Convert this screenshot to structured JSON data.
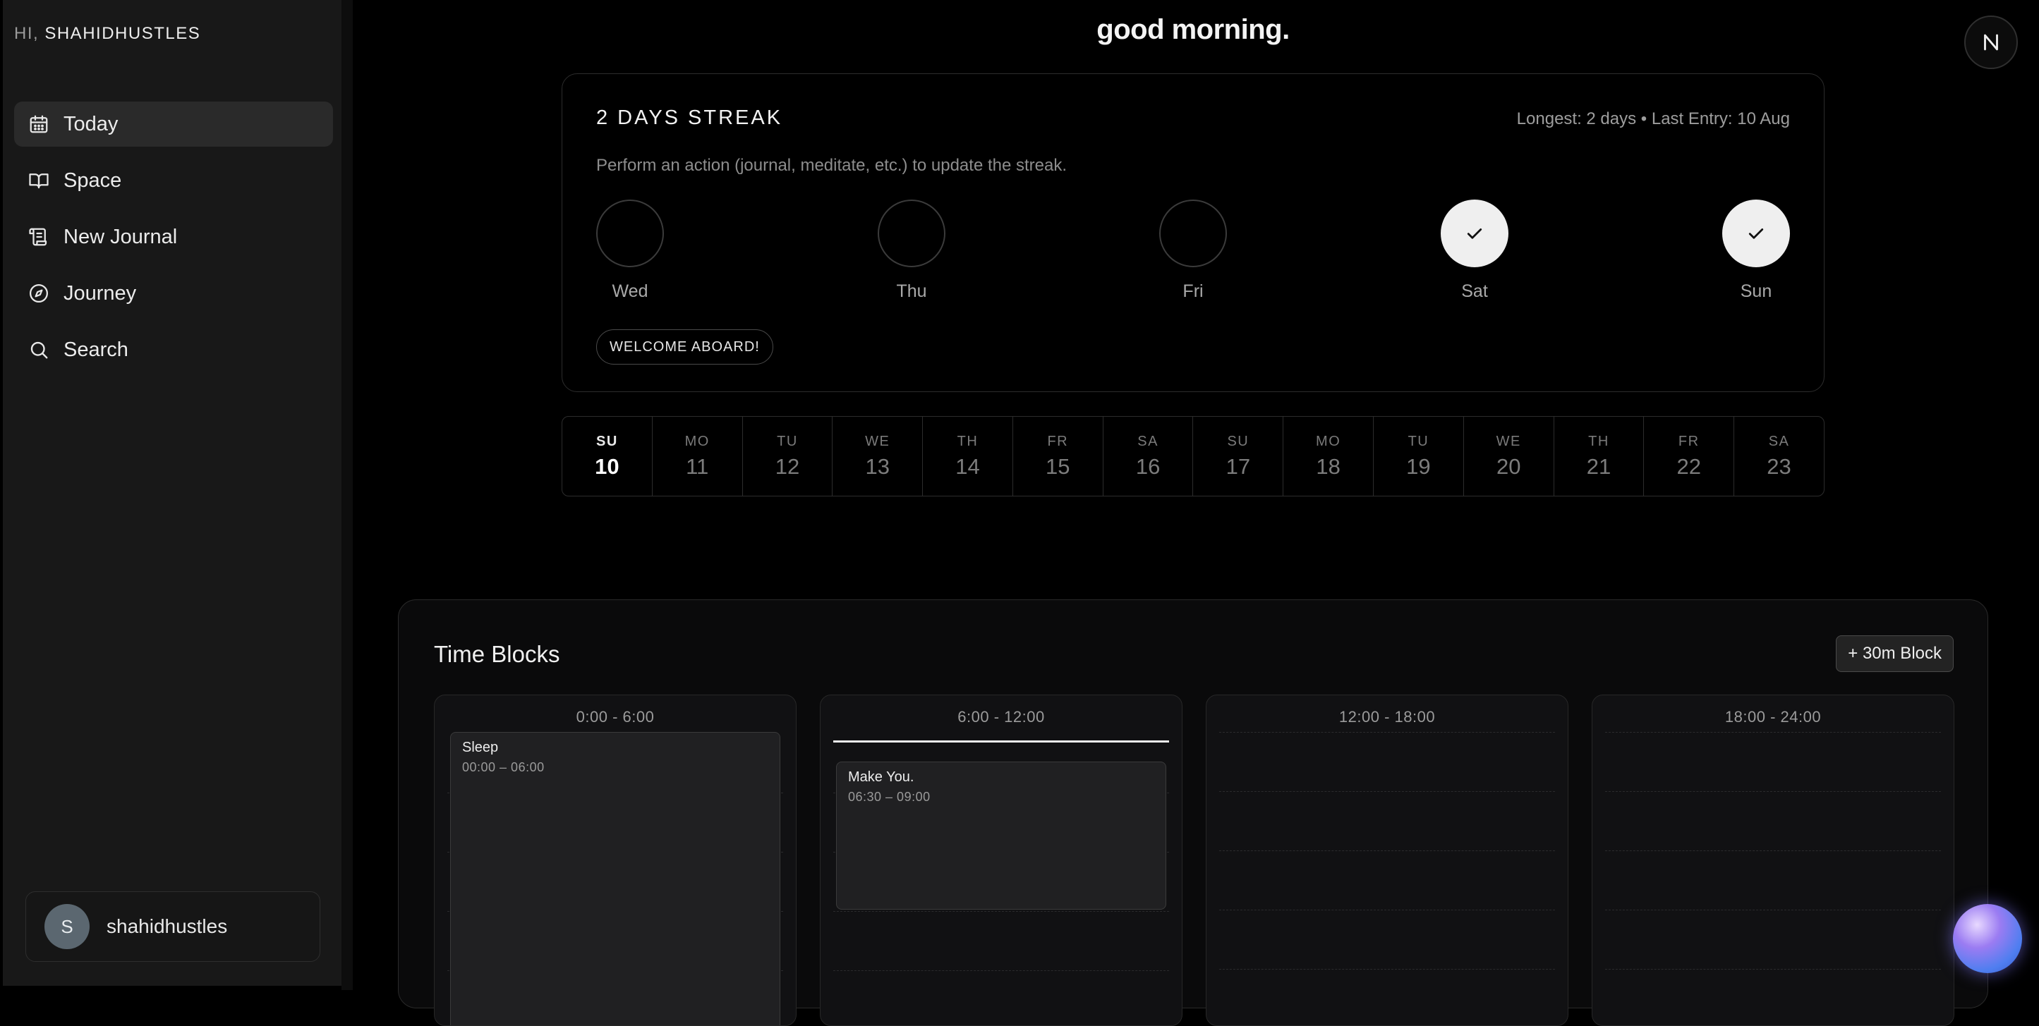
{
  "sidebar": {
    "greeting_prefix": "HI,",
    "greeting_user": "SHAHIDHUSTLES",
    "items": [
      {
        "label": "Today",
        "icon": "calendar-icon",
        "active": true
      },
      {
        "label": "Space",
        "icon": "book-open-icon",
        "active": false
      },
      {
        "label": "New Journal",
        "icon": "scroll-icon",
        "active": false
      },
      {
        "label": "Journey",
        "icon": "compass-icon",
        "active": false
      },
      {
        "label": "Search",
        "icon": "search-icon",
        "active": false
      }
    ],
    "user": {
      "avatar_initial": "S",
      "name": "shahidhustles"
    }
  },
  "header": {
    "title": "good morning.",
    "badge_letter": "N"
  },
  "streak": {
    "title": "2 DAYS STREAK",
    "meta": "Longest: 2 days • Last Entry: 10 Aug",
    "description": "Perform an action (journal, meditate, etc.) to update the streak.",
    "days": [
      {
        "label": "Wed",
        "done": false
      },
      {
        "label": "Thu",
        "done": false
      },
      {
        "label": "Fri",
        "done": false
      },
      {
        "label": "Sat",
        "done": true
      },
      {
        "label": "Sun",
        "done": true
      }
    ],
    "badge": "WELCOME ABOARD!"
  },
  "week": [
    {
      "dow": "SU",
      "num": "10",
      "active": true
    },
    {
      "dow": "MO",
      "num": "11"
    },
    {
      "dow": "TU",
      "num": "12"
    },
    {
      "dow": "WE",
      "num": "13"
    },
    {
      "dow": "TH",
      "num": "14"
    },
    {
      "dow": "FR",
      "num": "15"
    },
    {
      "dow": "SA",
      "num": "16"
    },
    {
      "dow": "SU",
      "num": "17"
    },
    {
      "dow": "MO",
      "num": "18"
    },
    {
      "dow": "TU",
      "num": "19"
    },
    {
      "dow": "WE",
      "num": "20"
    },
    {
      "dow": "TH",
      "num": "21"
    },
    {
      "dow": "FR",
      "num": "22"
    },
    {
      "dow": "SA",
      "num": "23"
    }
  ],
  "timeblocks": {
    "title": "Time Blocks",
    "add_label": "+ 30m Block",
    "columns": [
      {
        "range": "0:00 - 6:00"
      },
      {
        "range": "6:00 - 12:00"
      },
      {
        "range": "12:00 - 18:00"
      },
      {
        "range": "18:00 - 24:00"
      }
    ],
    "blocks": [
      {
        "name": "Sleep",
        "time": "00:00 – 06:00"
      },
      {
        "name": "Make You.",
        "time": "06:30 – 09:00"
      }
    ]
  },
  "colors": {
    "accent": "#f0f0f0",
    "background": "#000000",
    "sidebar": "#181818"
  }
}
